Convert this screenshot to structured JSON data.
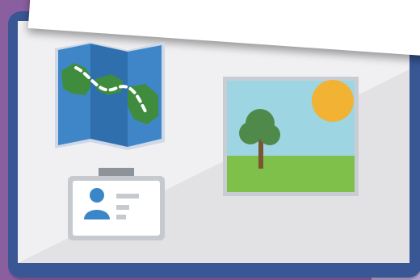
{
  "scene": {
    "background_color": "#8a5fa0",
    "frame_color": "#385794",
    "surface_color": "#f0f0f2",
    "icons": [
      {
        "name": "map-icon"
      },
      {
        "name": "landscape-photo-icon"
      },
      {
        "name": "id-badge-icon"
      }
    ]
  }
}
